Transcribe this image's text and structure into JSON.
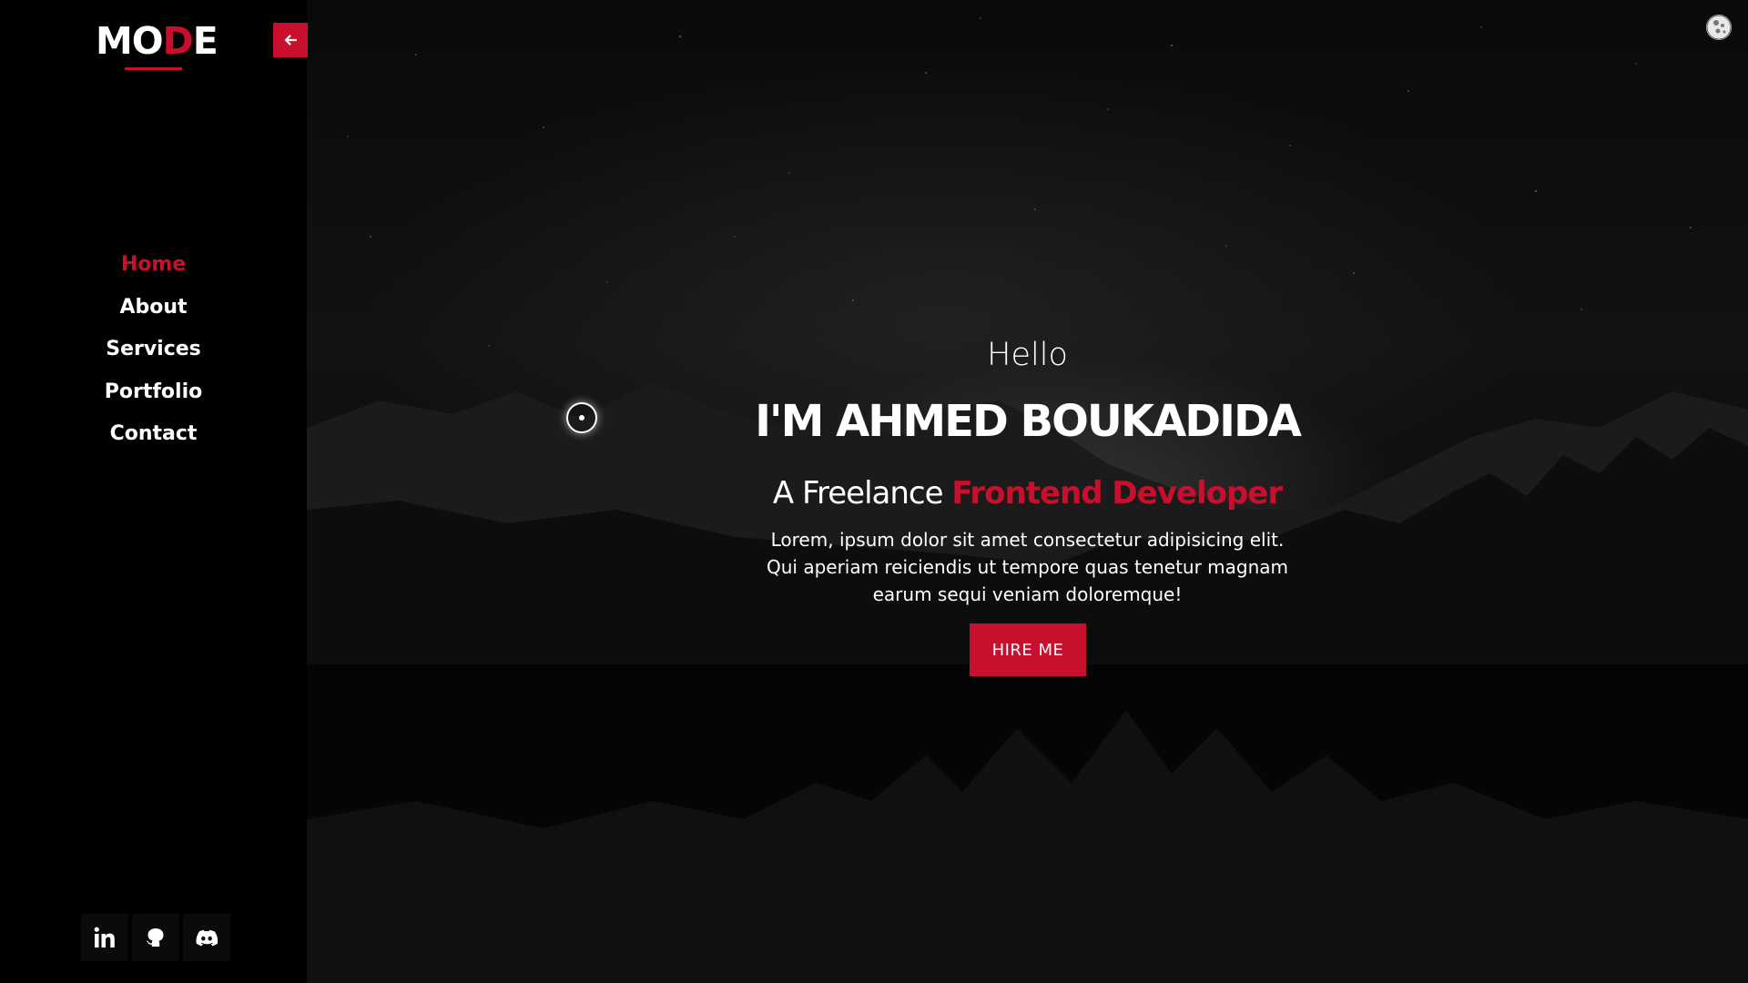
{
  "sidebar": {
    "logo": {
      "part1": "MO",
      "accent": "D",
      "part2": "E"
    },
    "collapse_icon": "arrow-left-icon",
    "nav": [
      {
        "label": "Home",
        "active": true
      },
      {
        "label": "About",
        "active": false
      },
      {
        "label": "Services",
        "active": false
      },
      {
        "label": "Portfolio",
        "active": false
      },
      {
        "label": "Contact",
        "active": false
      }
    ],
    "socials": [
      {
        "icon": "linkedin-icon"
      },
      {
        "icon": "github-icon"
      },
      {
        "icon": "discord-icon"
      }
    ]
  },
  "hero": {
    "greeting": "Hello",
    "name": "I'M AHMED BOUKADIDA",
    "role_prefix": "A Freelance",
    "role_highlight": "Frontend Developer",
    "description": "Lorem, ipsum dolor sit amet consectetur adipisicing elit. Qui aperiam reiciendis ut tempore quas tenetur magnam earum sequi veniam doloremque!",
    "cta_label": "HIRE ME"
  },
  "theme_toggle_icon": "moon-icon",
  "colors": {
    "accent": "#c8102e",
    "background": "#000000",
    "text": "#ffffff"
  }
}
